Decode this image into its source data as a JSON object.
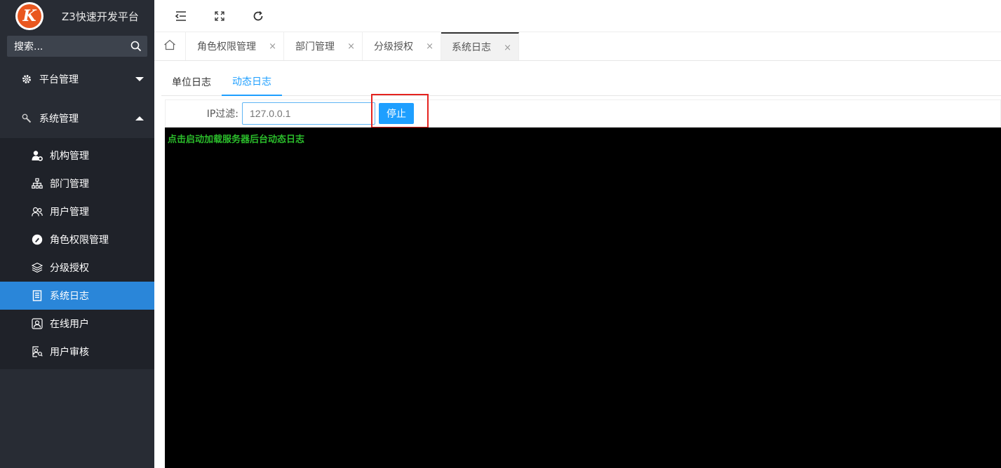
{
  "brand": {
    "title": "Z3快速开发平台",
    "logo_letter": "K"
  },
  "search": {
    "label": "搜索..."
  },
  "sidebar": {
    "groups": [
      {
        "label": "平台管理",
        "icon": "gear-icon",
        "expanded": false
      },
      {
        "label": "系统管理",
        "icon": "wrench-icon",
        "expanded": true
      }
    ],
    "items": [
      {
        "label": "机构管理",
        "icon": "user-gear-icon"
      },
      {
        "label": "部门管理",
        "icon": "org-chart-icon"
      },
      {
        "label": "用户管理",
        "icon": "users-icon"
      },
      {
        "label": "角色权限管理",
        "icon": "role-icon"
      },
      {
        "label": "分级授权",
        "icon": "layers-icon"
      },
      {
        "label": "系统日志",
        "icon": "document-icon",
        "active": true
      },
      {
        "label": "在线用户",
        "icon": "online-user-icon"
      },
      {
        "label": "用户审核",
        "icon": "user-audit-icon"
      }
    ]
  },
  "tabs": [
    {
      "label": "角色权限管理",
      "close": "×"
    },
    {
      "label": "部门管理",
      "close": "×"
    },
    {
      "label": "分级授权",
      "close": "×"
    },
    {
      "label": "系统日志",
      "close": "×",
      "active": true
    }
  ],
  "subtabs": [
    {
      "label": "单位日志"
    },
    {
      "label": "动态日志",
      "active": true
    }
  ],
  "filter": {
    "label": "IP过滤:",
    "placeholder": "127.0.0.1",
    "button": "停止"
  },
  "console": {
    "line": "点击启动加载服务器后台动态日志"
  },
  "colors": {
    "sidebar_bg": "#282c34",
    "active_item": "#2a86d9",
    "accent": "#1e9fff",
    "highlight_border": "#e5231f",
    "console_text": "#2bbd2b"
  }
}
